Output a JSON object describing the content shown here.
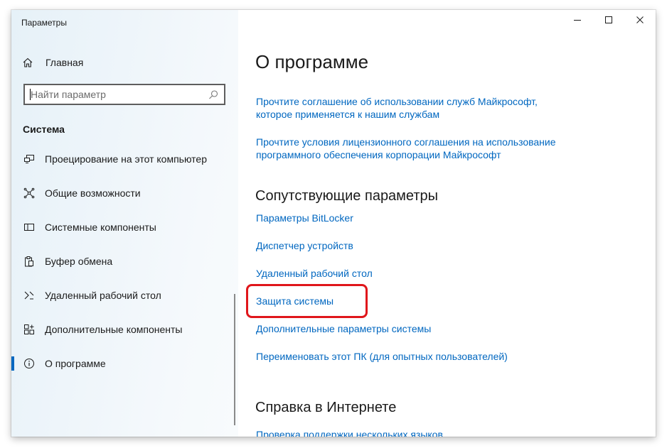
{
  "window": {
    "title": "Параметры"
  },
  "sidebar": {
    "home_label": "Главная",
    "search": {
      "placeholder": "Найти параметр",
      "value": ""
    },
    "section_label": "Система",
    "items": [
      {
        "label": "Проецирование на этот компьютер",
        "icon": "projecting-icon",
        "selected": false
      },
      {
        "label": "Общие возможности",
        "icon": "shared-experiences-icon",
        "selected": false
      },
      {
        "label": "Системные компоненты",
        "icon": "system-components-icon",
        "selected": false
      },
      {
        "label": "Буфер обмена",
        "icon": "clipboard-icon",
        "selected": false
      },
      {
        "label": "Удаленный рабочий стол",
        "icon": "remote-desktop-icon",
        "selected": false
      },
      {
        "label": "Дополнительные компоненты",
        "icon": "optional-features-icon",
        "selected": false
      },
      {
        "label": "О программе",
        "icon": "info-icon",
        "selected": true
      }
    ]
  },
  "main": {
    "page_title": "О программе",
    "agreement_links": [
      {
        "line1": "Прочтите соглашение об использовании служб Майкрософт,",
        "line2": "которое применяется к нашим службам"
      },
      {
        "line1": "Прочтите условия лицензионного соглашения на использование",
        "line2": "программного обеспечения корпорации Майкрософт"
      }
    ],
    "related_heading": "Сопутствующие параметры",
    "related_links": [
      "Параметры BitLocker",
      "Диспетчер устройств",
      "Удаленный рабочий стол",
      "Защита системы",
      "Дополнительные параметры системы",
      "Переименовать этот ПК (для опытных пользователей)"
    ],
    "help_heading": "Справка в Интернете",
    "help_links": [
      "Проверка поддержки нескольких языков"
    ]
  },
  "colors": {
    "accent": "#0067c0",
    "highlight": "#e0161b",
    "sidebar_bg": "#eaf3f9"
  }
}
